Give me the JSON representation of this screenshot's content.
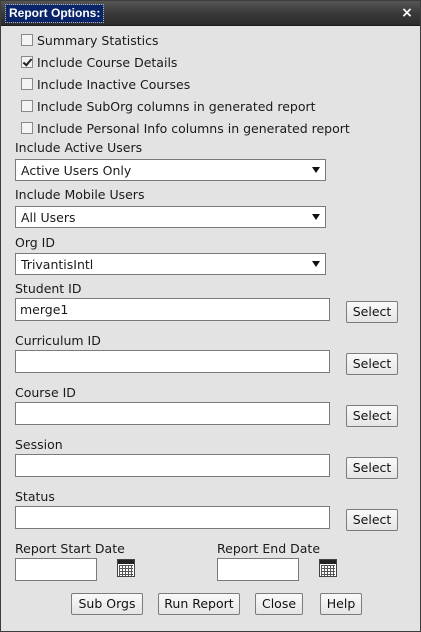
{
  "dialog": {
    "title": "Report Options:",
    "close_glyph": "×"
  },
  "checkboxes": [
    {
      "label": "Summary Statistics",
      "checked": false
    },
    {
      "label": "Include Course Details",
      "checked": true
    },
    {
      "label": "Include Inactive Courses",
      "checked": false
    },
    {
      "label": "Include SubOrg columns in generated report",
      "checked": false
    },
    {
      "label": "Include Personal Info columns in generated report",
      "checked": false
    }
  ],
  "active_users": {
    "label": "Include Active Users",
    "value": "Active Users Only"
  },
  "mobile_users": {
    "label": "Include Mobile Users",
    "value": "All Users"
  },
  "org_id": {
    "label": "Org ID",
    "value": "TrivantisIntl"
  },
  "fields": [
    {
      "label": "Student ID",
      "value": "merge1",
      "button": "Select"
    },
    {
      "label": "Curriculum ID",
      "value": "",
      "button": "Select"
    },
    {
      "label": "Course ID",
      "value": "",
      "button": "Select"
    },
    {
      "label": "Session",
      "value": "",
      "button": "Select"
    },
    {
      "label": "Status",
      "value": "",
      "button": "Select"
    }
  ],
  "dates": {
    "start_label": "Report Start Date",
    "start_value": "",
    "end_label": "Report End Date",
    "end_value": "",
    "icon": "calendar-icon"
  },
  "buttons": {
    "sub_orgs": "Sub Orgs",
    "run_report": "Run Report",
    "close": "Close",
    "help": "Help"
  },
  "colors": {
    "title_bar": "#3a3a3a",
    "title_highlight": "#0a246a",
    "dialog_bg": "#e3e3e3"
  }
}
